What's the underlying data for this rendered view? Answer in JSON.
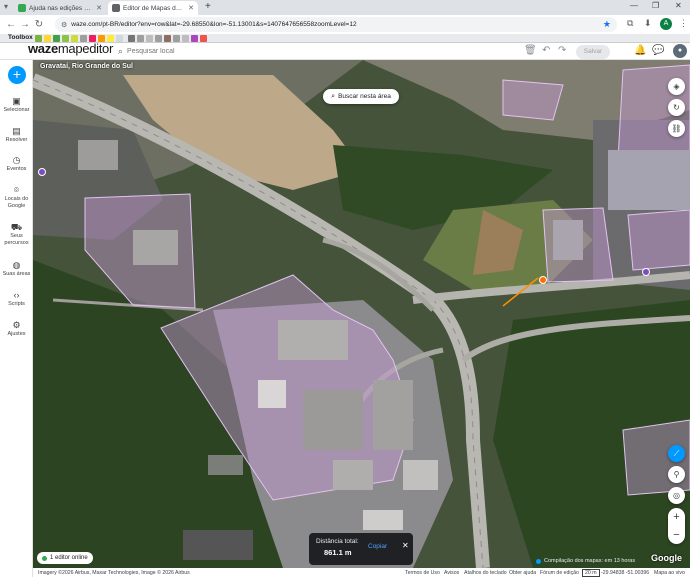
{
  "browser": {
    "tabs": [
      {
        "title": "Ajuda nas edições do mapa [P..."
      },
      {
        "title": "Editor de Mapas do Waze"
      }
    ],
    "url": "waze.com/pt-BR/editor?env=row&lat=-29.68550&lon=-51.13001&s=1407647656558zoomLevel=12"
  },
  "toolbox": {
    "label": "Toolbox"
  },
  "waze": {
    "logo_bold": "waze",
    "logo_light": "mapeditor",
    "search_placeholder": "Pesquisar local",
    "save_label": "Salvar"
  },
  "sidebar": {
    "items": [
      {
        "icon": "select-icon",
        "label": "Selecionar"
      },
      {
        "icon": "resolve-icon",
        "label": "Resolver"
      },
      {
        "icon": "events-icon",
        "label": "Eventos"
      },
      {
        "icon": "pin-icon",
        "label": "Locais do Google"
      },
      {
        "icon": "car-icon",
        "label": "Seus percursos"
      },
      {
        "icon": "globe-icon",
        "label": "Suas áreas"
      },
      {
        "icon": "code-icon",
        "label": "Scripts"
      },
      {
        "icon": "gear-icon",
        "label": "Ajustes"
      }
    ]
  },
  "map": {
    "location": "Gravataí, Rio Grande do Sul",
    "search_area": "Buscar nesta área",
    "distance": {
      "title": "Distância total:",
      "value": "861.1 m",
      "copy": "Copiar"
    },
    "editors_online": "1 editor online",
    "compile_note": "Compilação dos mapas: em 13 horas",
    "google": "Google"
  },
  "statusbar": {
    "imagery": "Imagery ©2026 Airbus, Maxar Technologies, Image © 2026 Airbus",
    "terms": "Termos de Uso",
    "notices": "Avisos",
    "shortcuts": "Atalhos do teclado",
    "help": "Obter ajuda",
    "forum": "Fórum de edição",
    "scale": "20 m",
    "coords": "-29.94838 -51.00396",
    "map_layer": "Mapa ao vivo"
  },
  "colors": {
    "accent": "#0099ff",
    "area_overlay": "#c79bd6",
    "panel_dark": "#202124"
  }
}
